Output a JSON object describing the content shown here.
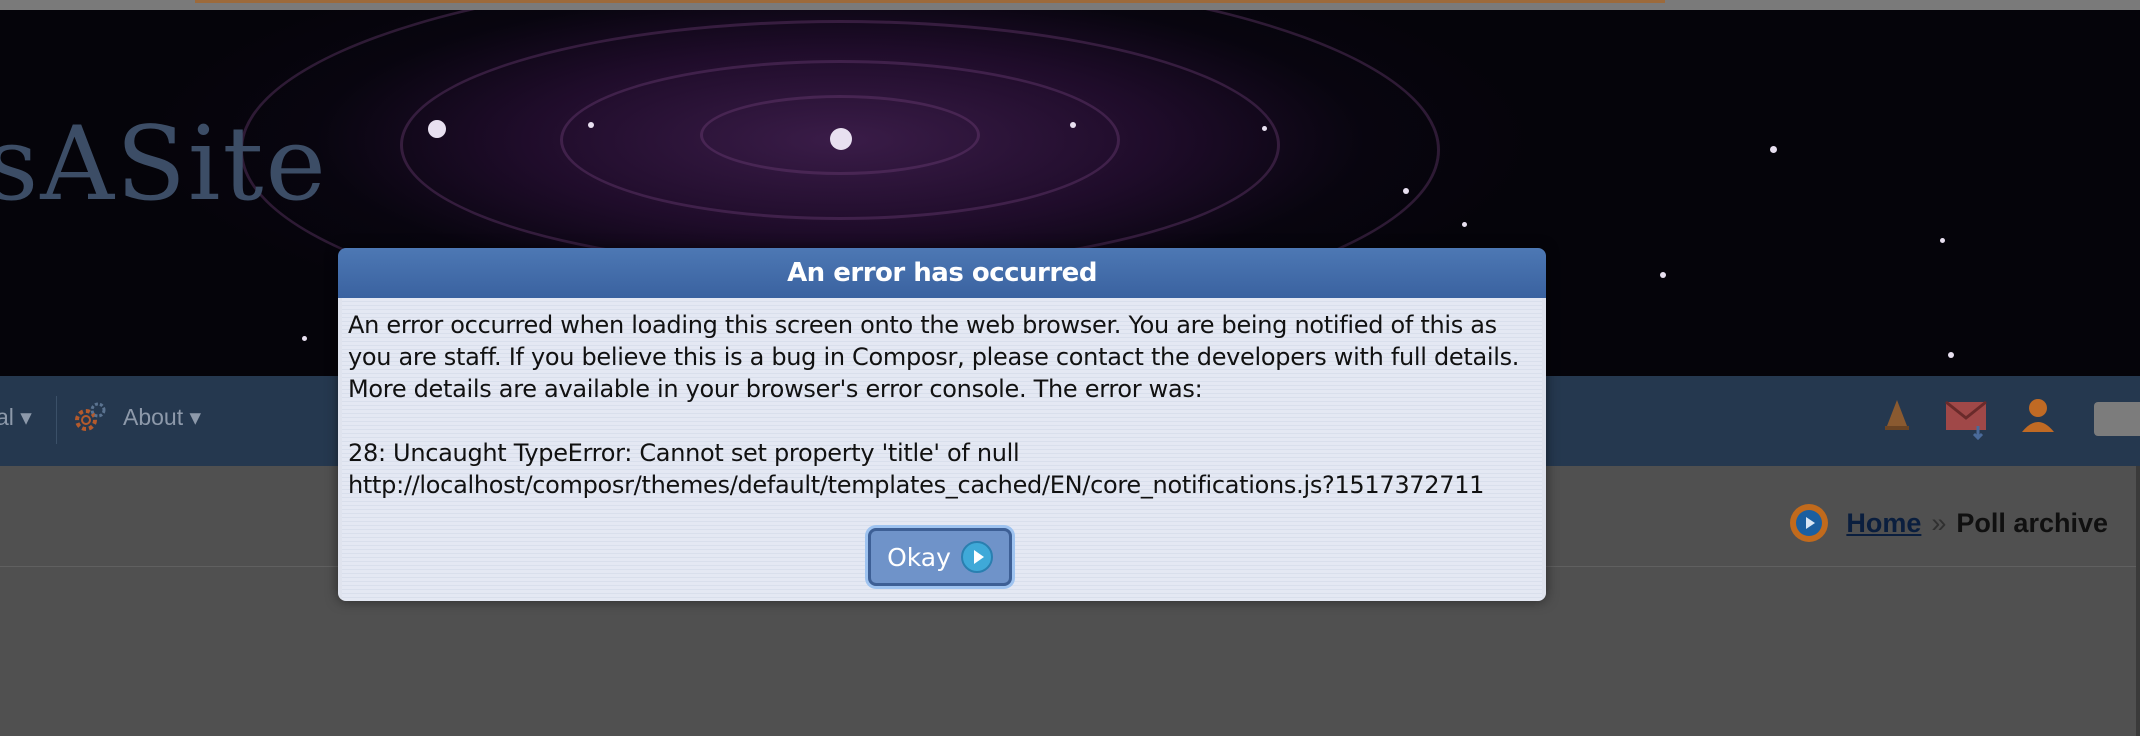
{
  "header": {
    "site_name": "sASite"
  },
  "nav": {
    "items": [
      {
        "label": "al ▾"
      },
      {
        "label": "About ▾"
      }
    ]
  },
  "breadcrumb": {
    "home": "Home",
    "separator": "»",
    "current": "Poll archive"
  },
  "dialog": {
    "title": "An error has occurred",
    "message": "An error occurred when loading this screen onto the web browser. You are being notified of this as\nyou are staff. If you believe this is a bug in Composr, please contact the developers with full details.\nMore details are available in your browser's error console. The error was:\n\n28: Uncaught TypeError: Cannot set property 'title' of null\nhttp://localhost/composr/themes/default/templates_cached/EN/core_notifications.js?1517372711",
    "okay_label": "Okay"
  },
  "colors": {
    "dialog_title_bg": "#4470ae",
    "nav_bg": "#25384f",
    "accent_orange": "#c16a1c"
  }
}
